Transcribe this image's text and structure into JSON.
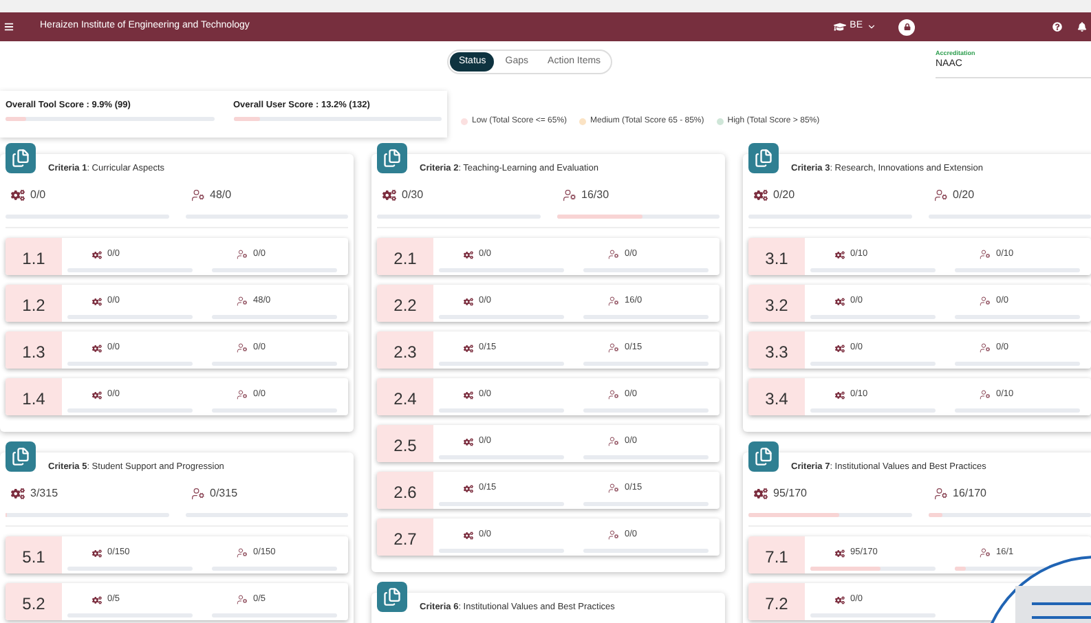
{
  "header": {
    "title": "Heraizen Institute of Engineering and Technology",
    "program": "BE"
  },
  "tabs": [
    {
      "label": "Status",
      "selected": true
    },
    {
      "label": "Gaps",
      "selected": false
    },
    {
      "label": "Action Items",
      "selected": false
    }
  ],
  "accreditation": {
    "label": "Accreditation",
    "value": "NAAC"
  },
  "overall": [
    {
      "label": "Overall Tool Score : 9.9% (99)",
      "level": 0.099
    },
    {
      "label": "Overall User Score : 13.2% (132)",
      "level": 0.132
    }
  ],
  "legend": [
    {
      "label": "Low (Total Score <= 65%)",
      "color": "#fbe0e0"
    },
    {
      "label": "Medium (Total Score 65 - 85%)",
      "color": "#fbe3c4"
    },
    {
      "label": "High (Total Score > 85%)",
      "color": "#cfe6d8"
    }
  ],
  "columns": [
    [
      {
        "title": "**Criteria 1**: Curricular Aspects",
        "tool": {
          "value": "0/0"
        },
        "user": {
          "value": "48/0"
        },
        "sections": [
          {
            "number": "1.1",
            "tool": {
              "value": "0/0"
            },
            "user": {
              "value": "0/0"
            }
          },
          {
            "number": "1.2",
            "tool": {
              "value": "0/0"
            },
            "user": {
              "value": "48/0"
            }
          },
          {
            "number": "1.3",
            "tool": {
              "value": "0/0"
            },
            "user": {
              "value": "0/0"
            }
          },
          {
            "number": "1.4",
            "tool": {
              "value": "0/0"
            },
            "user": {
              "value": "0/0"
            }
          }
        ]
      },
      {
        "title": "**Criteria 5**: Student Support and Progression",
        "tool": {
          "value": "3/315",
          "level": 0.01
        },
        "user": {
          "value": "0/315"
        },
        "sections": [
          {
            "number": "5.1",
            "tool": {
              "value": "0/150"
            },
            "user": {
              "value": "0/150"
            }
          },
          {
            "number": "5.2",
            "tool": {
              "value": "0/5"
            },
            "user": {
              "value": "0/5"
            }
          }
        ]
      }
    ],
    [
      {
        "title": "**Criteria 2**: Teaching-Learning and Evaluation",
        "tool": {
          "value": "0/30"
        },
        "user": {
          "value": "16/30",
          "level": 0.53
        },
        "sections": [
          {
            "number": "2.1",
            "tool": {
              "value": "0/0"
            },
            "user": {
              "value": "0/0"
            }
          },
          {
            "number": "2.2",
            "tool": {
              "value": "0/0"
            },
            "user": {
              "value": "16/0"
            }
          },
          {
            "number": "2.3",
            "tool": {
              "value": "0/15"
            },
            "user": {
              "value": "0/15"
            }
          },
          {
            "number": "2.4",
            "tool": {
              "value": "0/0"
            },
            "user": {
              "value": "0/0"
            }
          },
          {
            "number": "2.5",
            "tool": {
              "value": "0/0"
            },
            "user": {
              "value": "0/0"
            }
          },
          {
            "number": "2.6",
            "tool": {
              "value": "0/15"
            },
            "user": {
              "value": "0/15"
            }
          },
          {
            "number": "2.7",
            "tool": {
              "value": "0/0"
            },
            "user": {
              "value": "0/0"
            }
          }
        ]
      },
      {
        "title": "**Criteria 6**: Institutional Values and Best Practices"
      }
    ],
    [
      {
        "title": "**Criteria 3**: Research, Innovations and Extension",
        "tool": {
          "value": "0/20"
        },
        "user": {
          "value": "0/20"
        },
        "sections": [
          {
            "number": "3.1",
            "tool": {
              "value": "0/10"
            },
            "user": {
              "value": "0/10"
            }
          },
          {
            "number": "3.2",
            "tool": {
              "value": "0/0"
            },
            "user": {
              "value": "0/0"
            }
          },
          {
            "number": "3.3",
            "tool": {
              "value": "0/0"
            },
            "user": {
              "value": "0/0"
            }
          },
          {
            "number": "3.4",
            "tool": {
              "value": "0/10"
            },
            "user": {
              "value": "0/10"
            }
          }
        ]
      },
      {
        "title": "**Criteria 7**: Institutional Values and Best Practices",
        "tool": {
          "value": "95/170",
          "level": 0.56
        },
        "user": {
          "value": "16/170",
          "level": 0.09
        },
        "sections": [
          {
            "number": "7.1",
            "tool": {
              "value": "95/170",
              "level": 0.56
            },
            "user": {
              "value": "16/1",
              "level": 0.09
            }
          },
          {
            "number": "7.2",
            "tool": {
              "value": "0/0"
            }
          }
        ]
      }
    ]
  ]
}
